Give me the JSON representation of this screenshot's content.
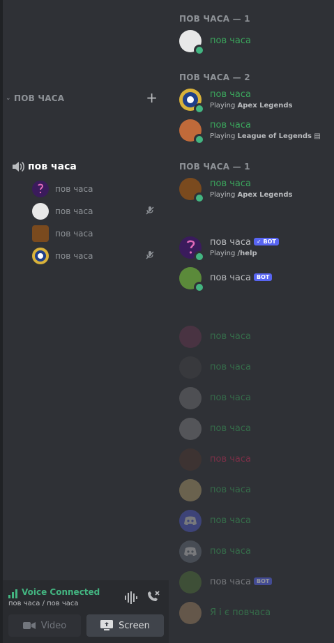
{
  "sidebar": {
    "category": "ПОВ ЧАСА",
    "voice_channel": "пов часа",
    "voice_users": [
      {
        "name": "пов часа",
        "avatar_color": "#3a1b5c",
        "muted": false
      },
      {
        "name": "пов часа",
        "avatar_color": "#e8e8e8",
        "muted": true
      },
      {
        "name": "пов часа",
        "avatar_color": "#7a4a1e",
        "muted": false
      },
      {
        "name": "пов часа",
        "avatar_color": "#d9b23a",
        "muted": true
      }
    ]
  },
  "voice_panel": {
    "title": "Voice Connected",
    "subtitle": "пов часа / пов часа",
    "video_label": "Video",
    "screen_label": "Screen"
  },
  "members": {
    "groups": [
      {
        "header": "ПОВ ЧАСА — 1"
      },
      {
        "header": "ПОВ ЧАСА — 2"
      },
      {
        "header": "ПОВ ЧАСА — 1"
      }
    ],
    "list": [
      {
        "name": "пов часа",
        "activity": "",
        "avatar_color": "#e8e8e8"
      },
      {
        "name": "пов часа",
        "activity_prefix": "Playing",
        "activity_game": "Apex Legends",
        "avatar_color": "#d9b23a"
      },
      {
        "name": "пов часа",
        "activity_prefix": "Playing",
        "activity_game": "League of Legends",
        "avatar_color": "#c06a3a"
      },
      {
        "name": "пов часа",
        "activity_prefix": "Playing",
        "activity_game": "Apex Legends",
        "avatar_color": "#7a4a1e"
      },
      {
        "name": "пов часа",
        "bot_label": "✓ BOT",
        "activity_prefix": "Playing",
        "activity_game": "/help",
        "avatar_color": "#3a1b5c"
      },
      {
        "name": "пов часа",
        "bot_label": "BOT",
        "avatar_color": "#5b8a3a"
      }
    ],
    "offline": [
      {
        "name": "пов часа",
        "avatar_color": "#7a3a5a",
        "name_color": "#3ba55c"
      },
      {
        "name": "пов часа",
        "avatar_color": "#4a4a4a",
        "name_color": "#3ba55c"
      },
      {
        "name": "пов часа",
        "avatar_color": "#8a8a8a",
        "name_color": "#3ba55c"
      },
      {
        "name": "пов часа",
        "avatar_color": "#9a9a9a",
        "name_color": "#3ba55c"
      },
      {
        "name": "пов часа",
        "avatar_color": "#5a3a2a",
        "name_color": "#c42e58"
      },
      {
        "name": "пов часа",
        "avatar_color": "#d9c07a",
        "name_color": "#3ba55c"
      },
      {
        "name": "пов часа",
        "avatar_color": "#5865f2",
        "name_color": "#3ba55c"
      },
      {
        "name": "пов часа",
        "avatar_color": "#747f8d",
        "name_color": "#3ba55c"
      },
      {
        "name": "пов часа",
        "bot_label": "BOT",
        "avatar_color": "#5b8a3a",
        "name_color": "#b9bbbe"
      },
      {
        "name": "Я і є повчаса",
        "avatar_color": "#c8a070",
        "name_color": "#3ba55c"
      }
    ]
  },
  "colors": {
    "online": "#43b581",
    "accent": "#5865f2",
    "bg": "#2f3136"
  }
}
